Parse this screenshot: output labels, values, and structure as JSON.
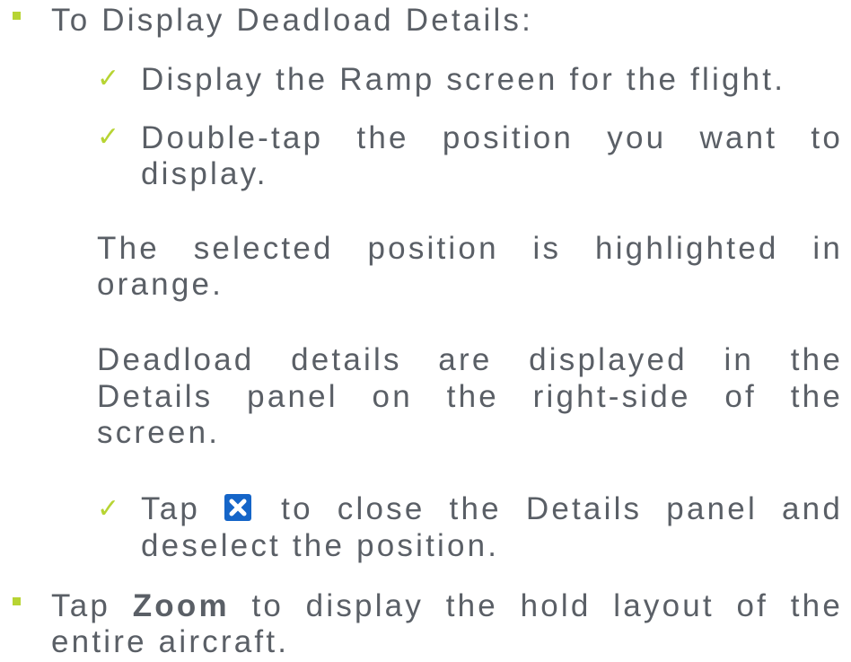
{
  "bullet1": {
    "heading": "To Display Deadload Details:",
    "steps": [
      "Display the Ramp screen for the flight.",
      "Double-tap the position you want to",
      "display."
    ],
    "note1": [
      "The selected position is highlighted in",
      "orange."
    ],
    "note2": [
      "Deadload details are displayed in the",
      "Details panel on the right-side of the",
      "screen."
    ],
    "tap_step": {
      "prefix": "Tap",
      "suffix": "to close the Details panel and",
      "line2": "deselect the position."
    }
  },
  "bullet2": {
    "prefix": "Tap",
    "bold": "Zoom",
    "suffix": "to display the hold layout of the",
    "line2": "entire aircraft."
  },
  "icons": {
    "bullet": "square-bullet",
    "check": "checkmark-icon",
    "close": "close-icon"
  },
  "colors": {
    "text": "#5a5f66",
    "accent": "#b7d433",
    "close_icon_bg": "#1565c8"
  }
}
